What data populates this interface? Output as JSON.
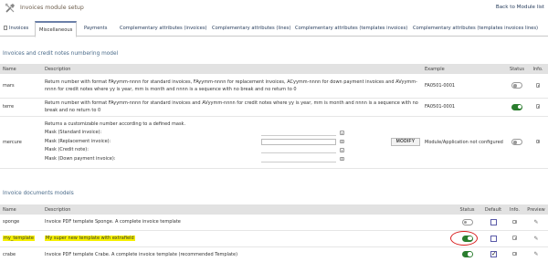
{
  "header": {
    "title": "Invoices module setup",
    "back_link": "Back to Module list"
  },
  "tabs": [
    {
      "label": "Invoices",
      "active": false
    },
    {
      "label": "Miscellaneous",
      "active": true
    },
    {
      "label": "Payments",
      "active": false
    },
    {
      "label": "Complementary attributes (invoices)",
      "active": false
    },
    {
      "label": "Complementary attributes (lines)",
      "active": false
    },
    {
      "label": "Complementary attributes (templates invoices)",
      "active": false
    },
    {
      "label": "Complementary attributes (templates invoices lines)",
      "active": false
    }
  ],
  "numbering": {
    "section_title": "Invoices and credit notes numbering model",
    "columns": {
      "name": "Name",
      "description": "Description",
      "example": "Example",
      "status": "Status",
      "info": "Info."
    },
    "rows": [
      {
        "name": "mars",
        "description": "Return number with format FAyymm-nnnn for standard invoices, FAyymm-nnnn for replacement invoices, ACyymm-nnnn for down payment invoices and AVyymm-nnnn for credit notes where yy is year, mm is month and nnnn is a sequence with no break and no return to 0",
        "example": "FA0501-0001",
        "status": "off"
      },
      {
        "name": "terre",
        "description": "Return number with format FAyymm-nnnn for standard invoices and AVyymm-nnnn for credit notes where yy is year, mm is month and nnnn is a sequence with no break and no return to 0",
        "example": "FA0501-0001",
        "status": "on"
      },
      {
        "name": "mercure",
        "description": "Returns a customizable number according to a defined mask.",
        "masks": [
          {
            "label": "Mask (Standard invoice):",
            "value": ""
          },
          {
            "label": "Mask (Replacement invoice):",
            "value": ""
          },
          {
            "label": "Mask (Credit note):",
            "value": ""
          },
          {
            "label": "Mask (Down payment invoice):",
            "value": ""
          }
        ],
        "modify_label": "MODIFY",
        "example": "Module/Application not configured",
        "status": "off"
      }
    ]
  },
  "documents": {
    "section_title": "Invoice documents models",
    "columns": {
      "name": "Name",
      "description": "Description",
      "status": "Status",
      "default": "Default",
      "info": "Info.",
      "preview": "Preview"
    },
    "rows": [
      {
        "name": "sponge",
        "description": "Invoice PDF template Sponge. A complete invoice template",
        "status": "off",
        "default": false,
        "highlight": false
      },
      {
        "name": "my_template",
        "description": "My super new template with extrafield",
        "status": "on",
        "default": false,
        "highlight": true
      },
      {
        "name": "crabe",
        "description": "Invoice PDF template Crabe. A complete invoice template (recommended Template)",
        "status": "on",
        "default": true,
        "highlight": false
      }
    ]
  },
  "colors": {
    "toggle_on": "#2a7d2e",
    "highlight": "#f6f000",
    "annotation_circle": "#d91f1f"
  }
}
